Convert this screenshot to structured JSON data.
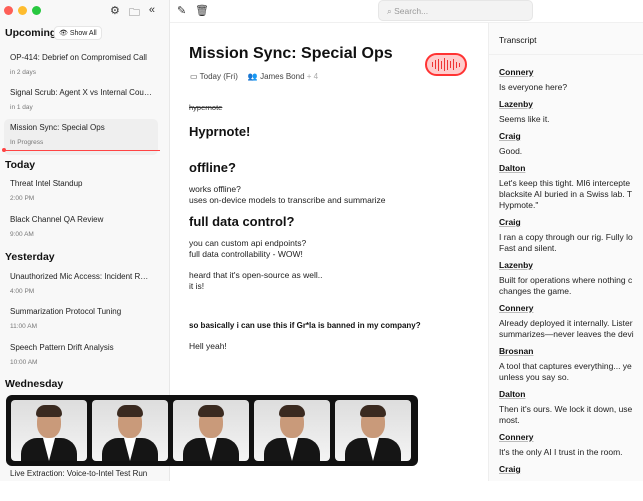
{
  "sidebar": {
    "show_all": "Show All",
    "sections": {
      "upcoming": "Upcoming",
      "today": "Today",
      "yesterday": "Yesterday",
      "wednesday": "Wednesday"
    },
    "upcoming": [
      {
        "title": "OP-414: Debrief on Compromised Call",
        "sub": "in 2 days"
      },
      {
        "title": "Signal Scrub: Agent X vs Internal Counterintelligence",
        "sub": "in 1 day"
      },
      {
        "title": "Mission Sync: Special Ops",
        "sub": "In Progress"
      }
    ],
    "today": [
      {
        "title": "Threat Intel Standup",
        "sub": "2:00 PM"
      },
      {
        "title": "Black Channel QA Review",
        "sub": "9:00 AM"
      }
    ],
    "yesterday": [
      {
        "title": "Unauthorized Mic Access: Incident Report",
        "sub": "4:00 PM"
      },
      {
        "title": "Summarization Protocol Tuning",
        "sub": "11:00 AM"
      },
      {
        "title": "Speech Pattern Drift Analysis",
        "sub": "10:00 AM"
      }
    ],
    "wednesday": [
      {
        "title": "Live Extraction: Voice-to-Intel Test Run"
      }
    ]
  },
  "toolbar": {
    "search_placeholder": "Search..."
  },
  "note": {
    "title": "Mission Sync: Special Ops",
    "date": "Today (Fri)",
    "participants": "James Bond",
    "extra": "+ 4",
    "strike": "hypernote",
    "h1": "Hyprnote!",
    "h_offline": "offline?",
    "offline_1": "works offline?",
    "offline_2": "uses on-device models to transcribe and summarize",
    "h_control": "full data control?",
    "control_1": "you can custom api endpoints?",
    "control_2": "full data controllability - WOW!",
    "os_1": "heard that it's open-source as well..",
    "os_2": "it is!",
    "question": "so basically i can use this if Gr*la is banned in my company?",
    "answer": "Hell yeah!"
  },
  "transcript": {
    "title": "Transcript",
    "lines": [
      {
        "speaker": "Connery",
        "text": "Is everyone here?"
      },
      {
        "speaker": "Lazenby",
        "text": "Seems like it."
      },
      {
        "speaker": "Craig",
        "text": "Good."
      },
      {
        "speaker": "Dalton",
        "text": "Let's keep this tight. MI6 intercepte\nblacksite AI buried in a Swiss lab. T\nHypmote.\""
      },
      {
        "speaker": "Craig",
        "text": "I ran a copy through our rig. Fully lo\nFast and silent."
      },
      {
        "speaker": "Lazenby",
        "text": "Built for operations where nothing c\nchanges the game."
      },
      {
        "speaker": "Connery",
        "text": "Already deployed it internally. Lister\nsummarizes—never leaves the devi"
      },
      {
        "speaker": "Brosnan",
        "text": "A tool that captures everything... ye\nunless you say so."
      },
      {
        "speaker": "Dalton",
        "text": "Then it's ours. We lock it down, use\nmost."
      },
      {
        "speaker": "Connery",
        "text": "It's the only AI I trust in the room."
      },
      {
        "speaker": "Craig",
        "text": ""
      }
    ]
  }
}
